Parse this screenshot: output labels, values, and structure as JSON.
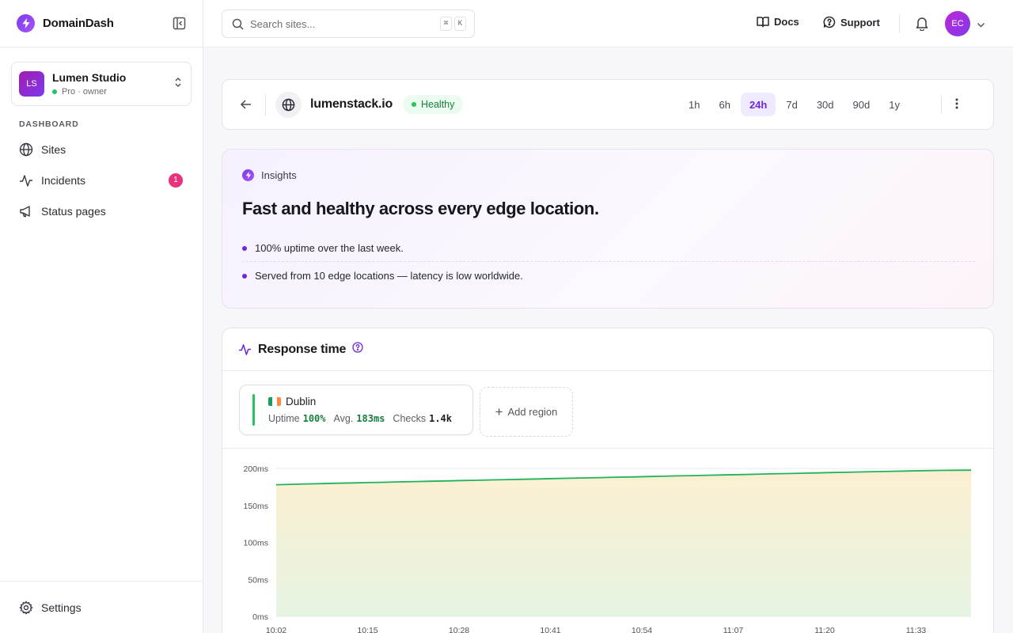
{
  "brand": {
    "name": "DomainDash"
  },
  "org": {
    "initials": "LS",
    "name": "Lumen Studio",
    "plan": "Pro · owner"
  },
  "nav": {
    "section_label": "DASHBOARD",
    "items": [
      {
        "label": "Sites",
        "icon": "globe-icon"
      },
      {
        "label": "Incidents",
        "icon": "activity-icon",
        "badge": "1"
      },
      {
        "label": "Status pages",
        "icon": "megaphone-icon"
      }
    ],
    "settings_label": "Settings"
  },
  "topbar": {
    "search_placeholder": "Search sites...",
    "shortcut_keys": [
      "⌘",
      "K"
    ],
    "docs_label": "Docs",
    "support_label": "Support",
    "user_initials": "EC"
  },
  "site": {
    "domain": "lumenstack.io",
    "status": "Healthy",
    "ranges": [
      "1h",
      "6h",
      "24h",
      "7d",
      "30d",
      "90d",
      "1y"
    ],
    "active_range": "24h"
  },
  "insights": {
    "label": "Insights",
    "title": "Fast and healthy across every edge location.",
    "items": [
      "100% uptime over the last week.",
      "Served from 10 edge locations — latency is low worldwide."
    ]
  },
  "response": {
    "title": "Response time",
    "region": {
      "name": "Dublin",
      "uptime_label": "Uptime",
      "uptime": "100%",
      "avg_label": "Avg.",
      "avg": "183ms",
      "checks_label": "Checks",
      "checks": "1.4k"
    },
    "add_region_label": "Add region"
  },
  "colors": {
    "accent": "#6d28d9",
    "healthy": "#22c55e",
    "line": "#22b35a",
    "incident_badge": "#e8327b"
  },
  "chart_data": {
    "type": "area",
    "y_ticks": [
      "0ms",
      "50ms",
      "100ms",
      "150ms",
      "200ms"
    ],
    "x_ticks": [
      "10:02",
      "10:15",
      "10:28",
      "10:41",
      "10:54",
      "11:07",
      "11:20",
      "11:33"
    ],
    "ylim": [
      0,
      200
    ],
    "grid": true,
    "series": [
      {
        "values": [
          178,
          178.5,
          179,
          179.5,
          180,
          180.4,
          180.9,
          181.3,
          181.8,
          182.2,
          182.7,
          183.1,
          183.6,
          184,
          184.5,
          184.9,
          185.4,
          185.8,
          186.3,
          186.7,
          187.2,
          187.6,
          188.1,
          188.5,
          189,
          189.4,
          189.9,
          190.3,
          190.8,
          191.2,
          191.7,
          192.1,
          192.6,
          193,
          193.5,
          193.9,
          194.4,
          194.8,
          195.3,
          195.7,
          196.2,
          196.6,
          197,
          197.3,
          197.5,
          197.7
        ]
      }
    ]
  }
}
